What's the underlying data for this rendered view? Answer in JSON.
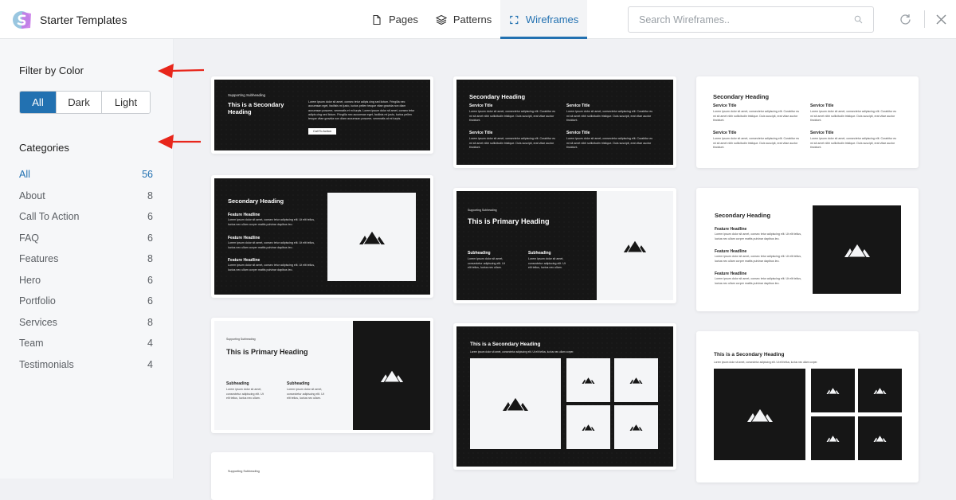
{
  "header": {
    "app_title": "Starter Templates",
    "logo_icon": "starter-templates-logo",
    "tabs": [
      {
        "label": "Pages",
        "icon": "page-icon",
        "active": false
      },
      {
        "label": "Patterns",
        "icon": "layers-icon",
        "active": false
      },
      {
        "label": "Wireframes",
        "icon": "frame-icon",
        "active": true
      }
    ],
    "search_placeholder": "Search Wireframes..",
    "search_value": "",
    "refresh_icon": "refresh-icon",
    "close_icon": "close-icon",
    "accent_color": "#2271b1"
  },
  "sidebar": {
    "filter_title": "Filter by Color",
    "color_filters": [
      {
        "label": "All",
        "active": true
      },
      {
        "label": "Dark",
        "active": false
      },
      {
        "label": "Light",
        "active": false
      }
    ],
    "categories_title": "Categories",
    "categories": [
      {
        "label": "All",
        "count": "56",
        "active": true
      },
      {
        "label": "About",
        "count": "8"
      },
      {
        "label": "Call To Action",
        "count": "6"
      },
      {
        "label": "FAQ",
        "count": "6"
      },
      {
        "label": "Features",
        "count": "8"
      },
      {
        "label": "Hero",
        "count": "6"
      },
      {
        "label": "Portfolio",
        "count": "6"
      },
      {
        "label": "Services",
        "count": "8"
      },
      {
        "label": "Team",
        "count": "4"
      },
      {
        "label": "Testimonials",
        "count": "4"
      }
    ],
    "annotation_arrow_color": "#e8261b"
  },
  "wireframes": {
    "cta_dark": {
      "subheading": "Supporting Subheading",
      "heading": "This is a Secondary Heading",
      "body": "Lorem ipsum dolor sit amet, consec tetur adipis cing sed lictum. Fringilla nec accumsan eget, facilisis mi justo, luctus pellen tesque vitae gravida non diam accumsan posuere, venenatis et mi turpis. Lorem ipsum dolor sit amet, consec tetur adipis cing sed lictum. Fringilla nec accumsan eget, facilisis mi justo, luctus pellen tesque vitae gravida non diam accumsan posuere, venenatis at mi turpis.",
      "button": "Call To Action"
    },
    "services_dark": {
      "heading": "Secondary Heading",
      "item_title": "Service Title",
      "item_body": "Lorem ipsum dolor sit amet, consectetur adipiscing elit. Curabitur eu mi sit amet nibh sollicitudin tristique. Duis suscipit, erat vitae auctor tincidunt."
    },
    "services_light": {
      "heading": "Secondary Heading",
      "item_title": "Service Title",
      "item_body": "Lorem ipsum dolor sit amet, consectetur adipiscing elit. Curabitur eu mi sit amet nibh sollicitudin tristique. Duis suscipit, erat vitae auctor tincidunt."
    },
    "features_dark": {
      "heading": "Secondary Heading",
      "item_title": "Feature Headline",
      "item_body": "Lorem ipsum dolor sit amet, consec tetur adipiscing elit. Ut elit tellus, luctus nec ullam corper mattis pulvinar dapibus leo."
    },
    "hero_dark": {
      "subheading": "Supporting Subheading",
      "heading": "This is Primary Heading",
      "col_title": "Subheading",
      "col_body": "Lorem ipsum dolor sit amet, consectetur adipiscing elit. Ut elit tellus, luctus nec ullam."
    },
    "features_light": {
      "heading": "Secondary Heading",
      "item_title": "Feature Headline",
      "item_body": "Lorem ipsum dolor sit amet, consec tetur adipiscing elit. Ut elit tellus, luctus nec ullam corper mattis pulvinar dapibus leo."
    },
    "hero_light": {
      "subheading": "Supporting Subheading",
      "heading": "This is Primary Heading",
      "col_title": "Subheading",
      "col_body": "Lorem ipsum dolor sit amet, consectetur adipiscing elit. Ut elit tellus, luctus nec ullam."
    },
    "gallery_dark": {
      "heading": "This is a Secondary Heading",
      "body": "Lorem ipsum dolor sit amet, consectetur adipiscing elit. Ut elit tellus, luctus nec ullam corper."
    },
    "gallery_light": {
      "heading": "This is a Secondary Heading",
      "body": "Lorem ipsum dolor sit amet, consectetur adipiscing elit. Ut elit tellus, luctus nec ullam corper."
    },
    "partial": {
      "subheading": "Supporting Subheading"
    }
  }
}
